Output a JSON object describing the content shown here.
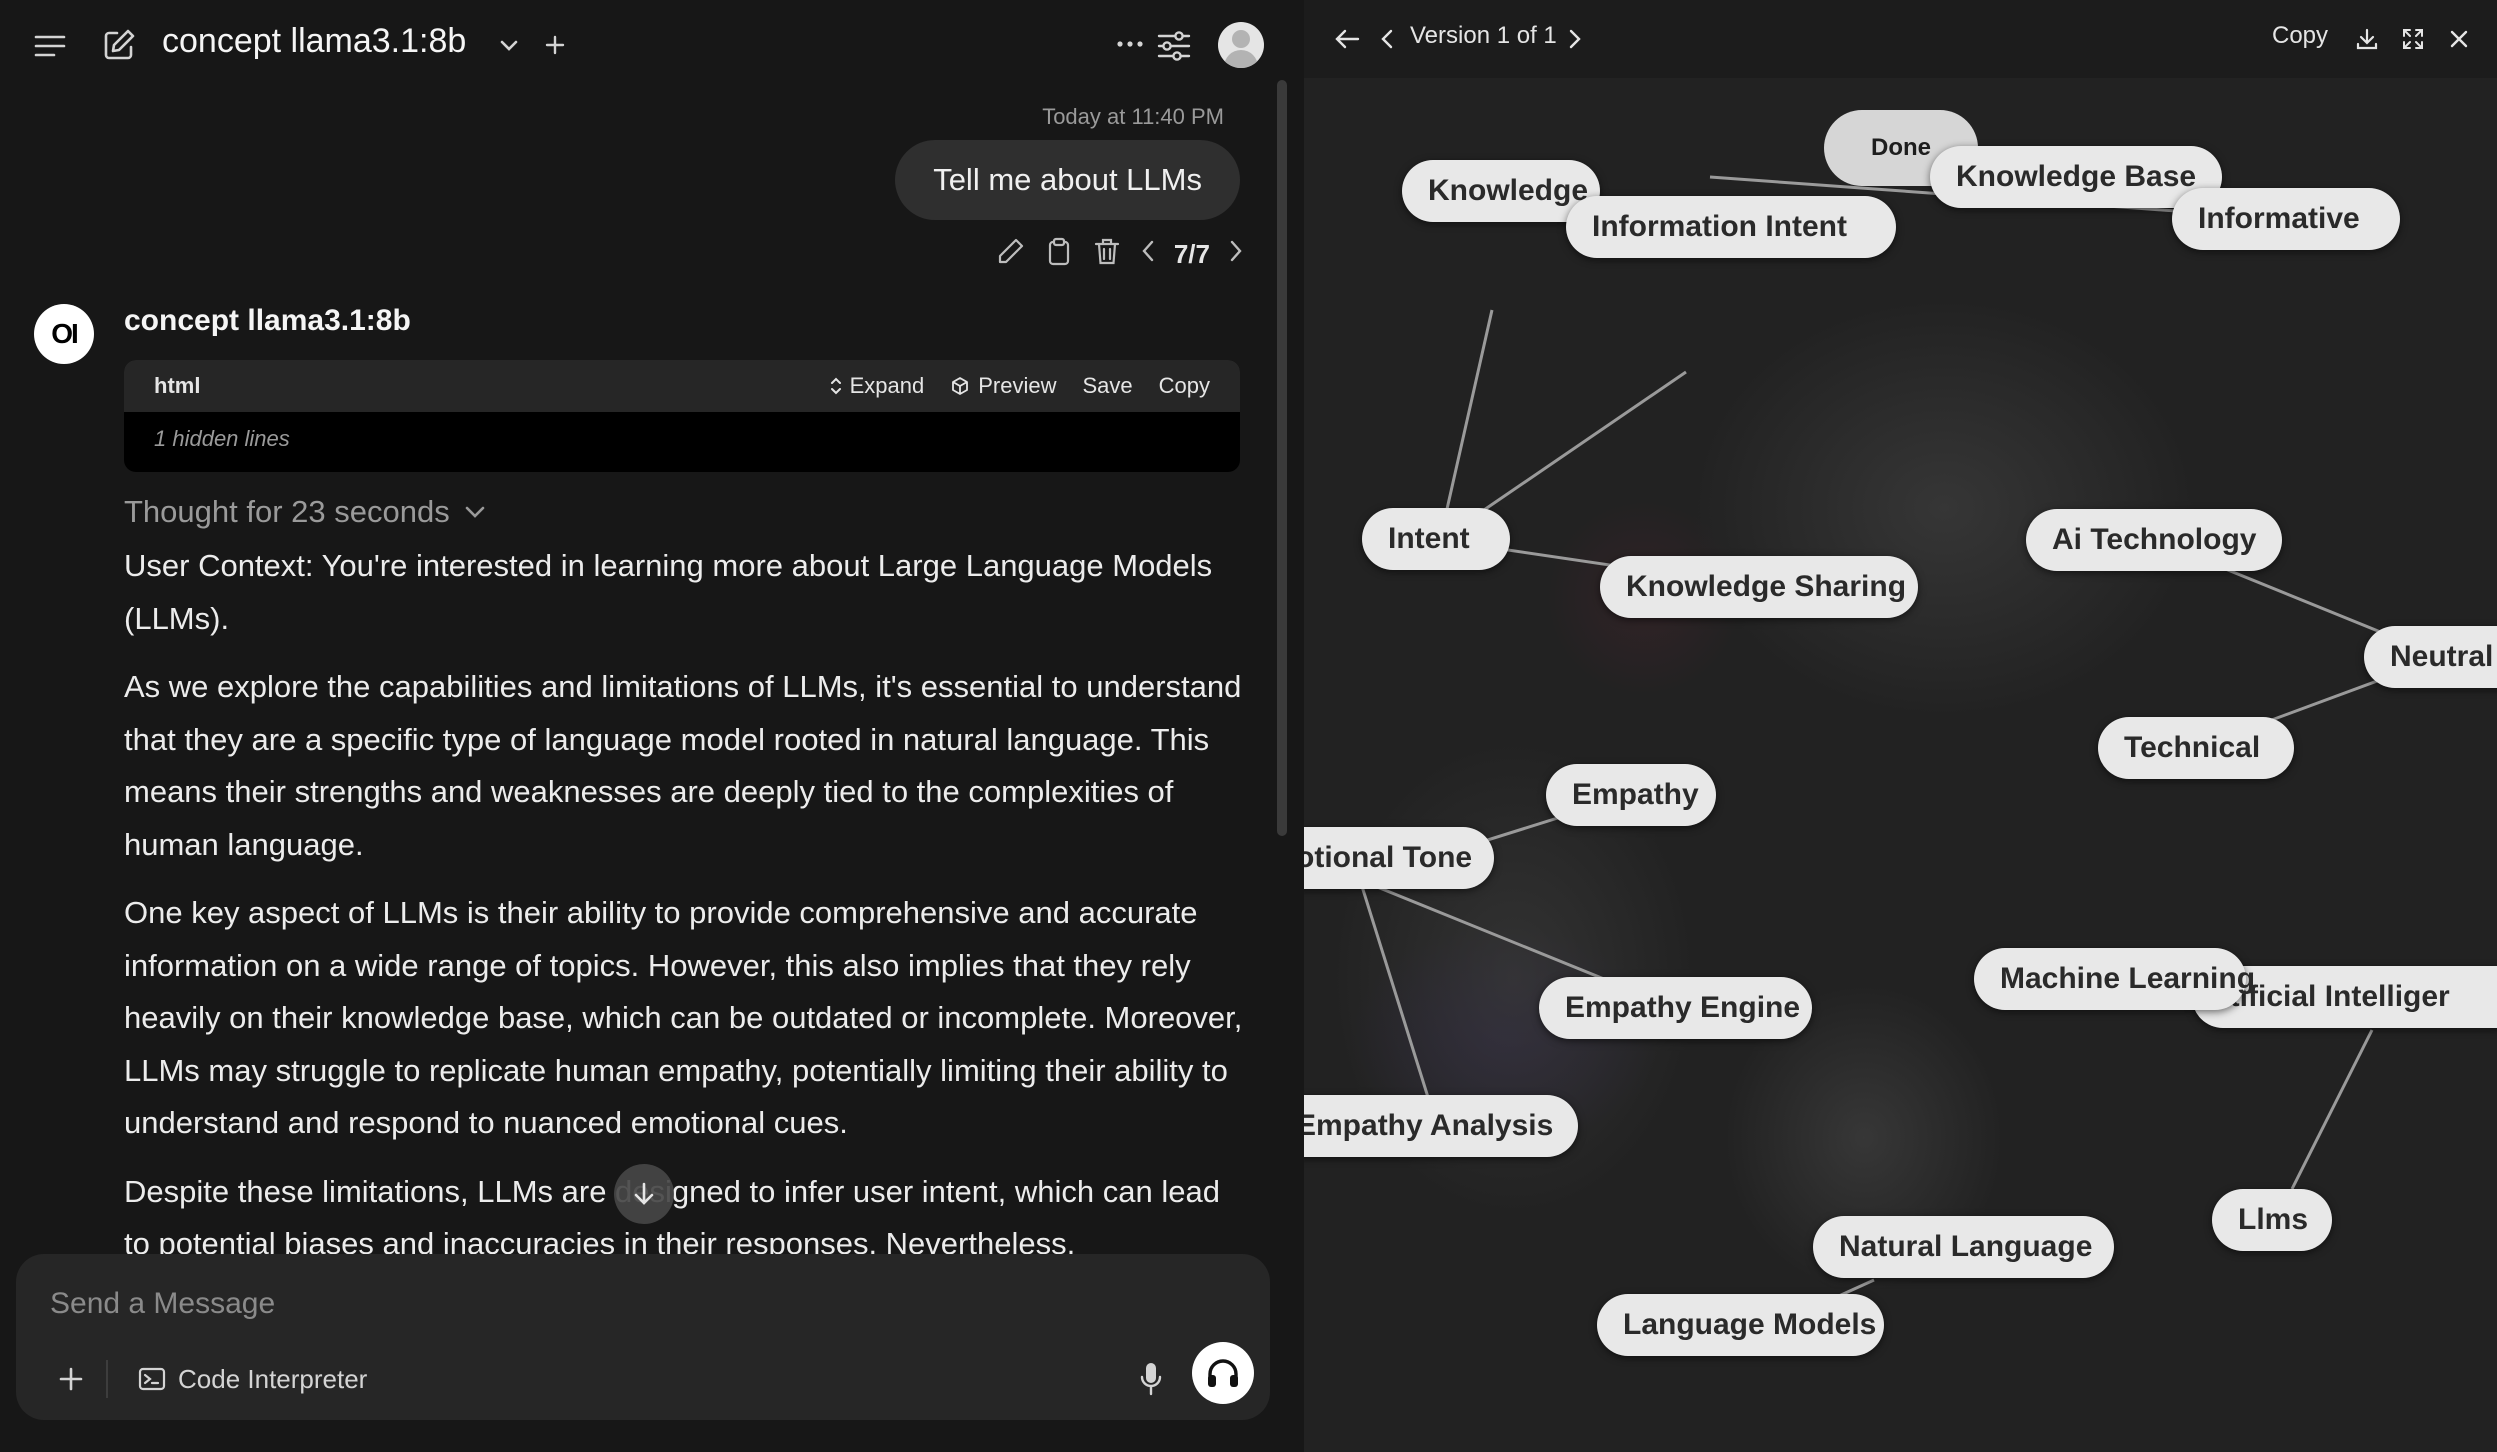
{
  "header": {
    "model_title": "concept llama3.1:8b",
    "icons": [
      "sidebar-menu-icon",
      "new-chat-icon",
      "chevron-down-icon",
      "plus-icon",
      "more-icon",
      "controls-icon",
      "user-avatar"
    ]
  },
  "chat": {
    "timestamp": "Today at 11:40 PM",
    "user_message": "Tell me about LLMs",
    "sibling_counter": "7/7",
    "bot_logo": "OI",
    "bot_name": "concept llama3.1:8b",
    "code_block": {
      "language": "html",
      "expand_label": "Expand",
      "preview_label": "Preview",
      "save_label": "Save",
      "copy_label": "Copy",
      "hidden_lines": "1 hidden lines"
    },
    "thought_label": "Thought for 23 seconds",
    "paragraphs": [
      "User Context: You're interested in learning more about Large Language Models (LLMs).",
      "As we explore the capabilities and limitations of LLMs, it's essential to understand that they are a specific type of language model rooted in natural language. This means their strengths and weaknesses are deeply tied to the complexities of human language.",
      "One key aspect of LLMs is their ability to provide comprehensive and accurate information on a wide range of topics. However, this also implies that they rely heavily on their knowledge base, which can be outdated or incomplete. Moreover, LLMs may struggle to replicate human empathy, potentially limiting their ability to understand and respond to nuanced emotional cues.",
      "Despite these limitations, LLMs are designed to infer user intent, which can lead to potential biases and inaccuracies in their responses. Nevertheless,"
    ]
  },
  "composer": {
    "placeholder": "Send a Message",
    "code_interpreter_label": "Code Interpreter"
  },
  "artifact": {
    "version_label": "Version 1 of 1",
    "copy_label": "Copy",
    "done_label": "Done",
    "nodes": [
      {
        "id": "knowledge-base",
        "label": "Knowledge Base"
      },
      {
        "id": "informative",
        "label": "Informative"
      },
      {
        "id": "knowledge",
        "label": "Knowledge"
      },
      {
        "id": "information-intent",
        "label": "Information Intent"
      },
      {
        "id": "intent",
        "label": "Intent"
      },
      {
        "id": "knowledge-sharing",
        "label": "Knowledge Sharing"
      },
      {
        "id": "ai-technology",
        "label": "Ai Technology"
      },
      {
        "id": "neutral",
        "label": "Neutral"
      },
      {
        "id": "technical",
        "label": "Technical"
      },
      {
        "id": "empathy",
        "label": "Empathy"
      },
      {
        "id": "emotional-tone",
        "label": "otional Tone"
      },
      {
        "id": "empathy-engine",
        "label": "Empathy Engine"
      },
      {
        "id": "machine-learning",
        "label": "Machine Learning"
      },
      {
        "id": "artificial-intelligence",
        "label": "rtificial Intelliger"
      },
      {
        "id": "empathy-analysis",
        "label": "Empathy Analysis"
      },
      {
        "id": "llms",
        "label": "Llms"
      },
      {
        "id": "natural-language",
        "label": "Natural Language"
      },
      {
        "id": "language-models",
        "label": "Language Models"
      }
    ],
    "edges": [
      [
        "knowledge-base",
        "informative"
      ],
      [
        "knowledge",
        "intent"
      ],
      [
        "information-intent",
        "intent"
      ],
      [
        "intent",
        "knowledge-sharing"
      ],
      [
        "ai-technology",
        "neutral"
      ],
      [
        "technical",
        "neutral"
      ],
      [
        "emotional-tone",
        "empathy"
      ],
      [
        "emotional-tone",
        "empathy-engine"
      ],
      [
        "emotional-tone",
        "empathy-analysis"
      ],
      [
        "artificial-intelligence",
        "llms"
      ],
      [
        "natural-language",
        "language-models"
      ]
    ]
  },
  "colors": {
    "app_bg": "#171717",
    "bubble_bg": "#2f2f2f",
    "composer_bg": "#262626",
    "artifact_bg": "#222222",
    "node_bg": "#e8e8e8",
    "node_text": "#2a2a2a"
  }
}
